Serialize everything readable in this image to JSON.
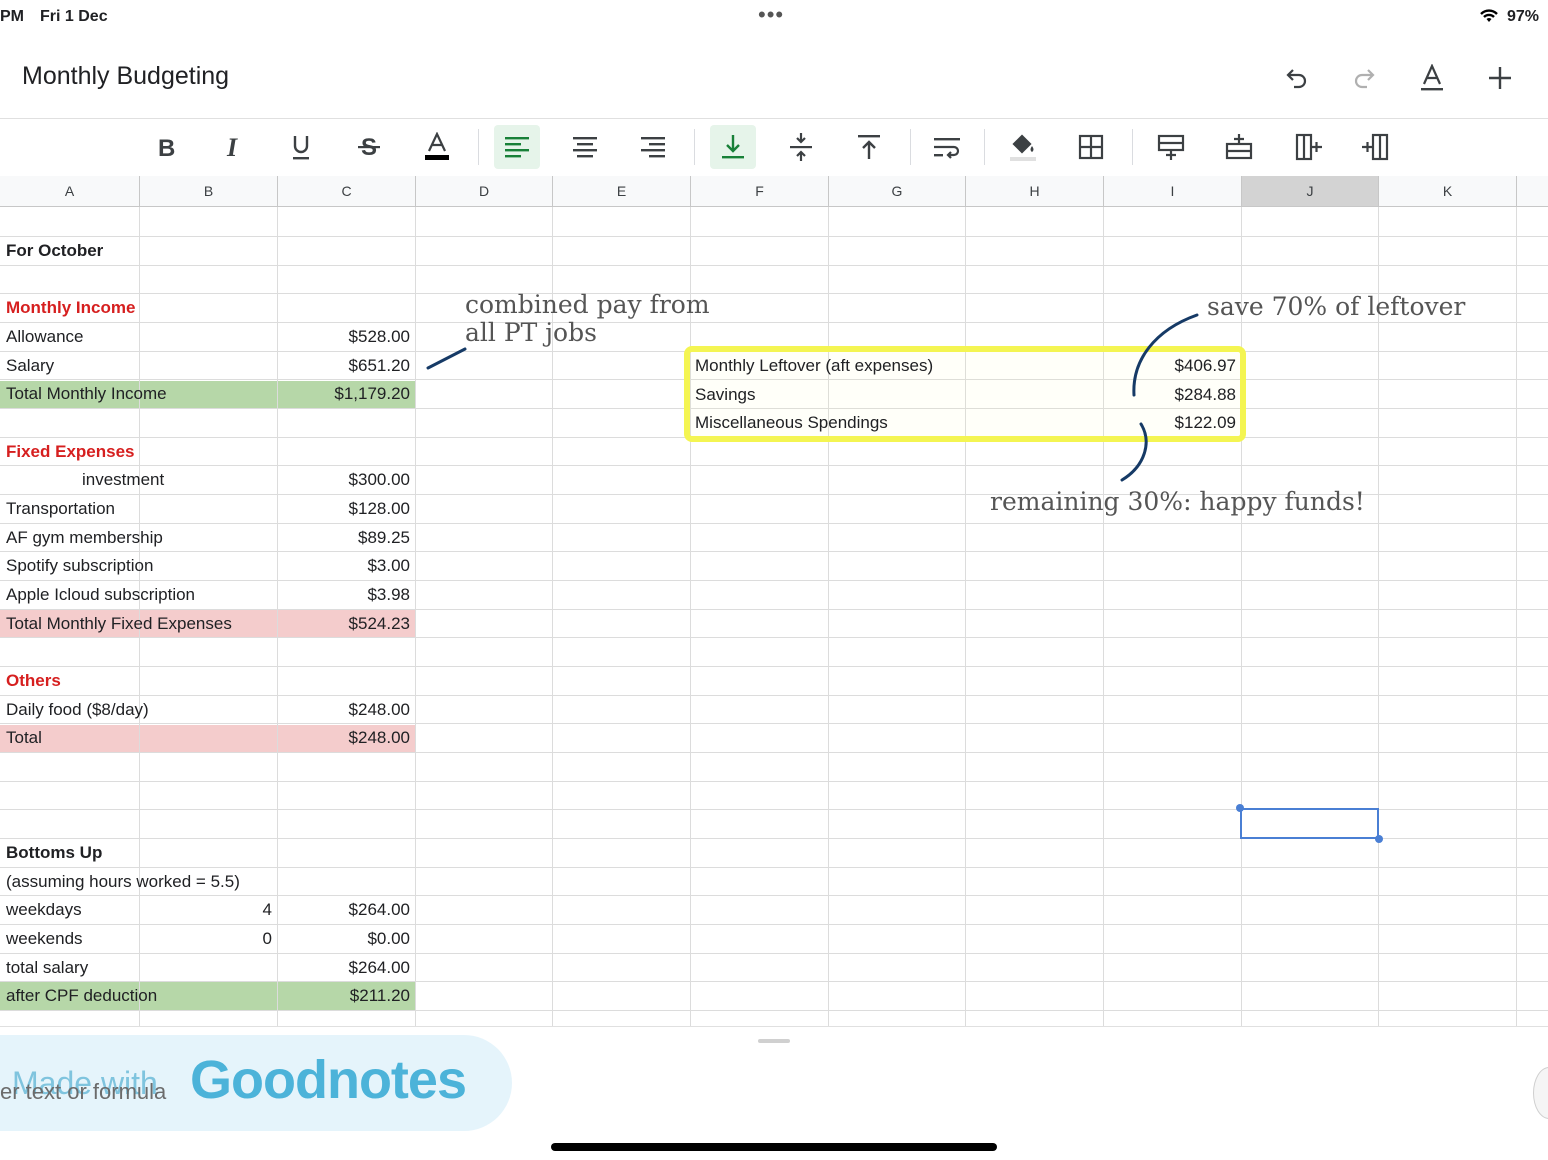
{
  "status": {
    "time": "PM",
    "date": "Fri 1 Dec",
    "battery": "97%"
  },
  "document": {
    "title": "Monthly Budgeting"
  },
  "title_actions": [
    "undo-icon",
    "redo-icon",
    "text-format-icon",
    "add-icon"
  ],
  "toolbar": [
    "bold-icon",
    "italic-icon",
    "underline-icon",
    "strikethrough-icon",
    "text-color-icon",
    "align-left-icon",
    "align-center-icon",
    "align-right-icon",
    "valign-bottom-icon",
    "valign-middle-icon",
    "valign-top-icon",
    "wrap-text-icon",
    "fill-color-icon",
    "borders-icon",
    "insert-row-above-icon",
    "insert-row-below-icon",
    "insert-column-left-icon",
    "insert-column-right-icon"
  ],
  "columns": [
    "A",
    "B",
    "C",
    "D",
    "E",
    "F",
    "G",
    "H",
    "I",
    "J",
    "K"
  ],
  "selected_column": "J",
  "sheet": {
    "for_october": "For October",
    "income": {
      "heading": "Monthly Income",
      "allowance_label": "Allowance",
      "allowance": "$528.00",
      "salary_label": "Salary",
      "salary": "$651.20",
      "total_label": "Total Monthly Income",
      "total": "$1,179.20"
    },
    "fixed": {
      "heading": "Fixed Expenses",
      "investment_label": "investment",
      "investment": "$300.00",
      "transport_label": "Transportation",
      "transport": "$128.00",
      "gym_label": "AF gym membership",
      "gym": "$89.25",
      "spotify_label": "Spotify subscription",
      "spotify": "$3.00",
      "icloud_label": "Apple Icloud subscription",
      "icloud": "$3.98",
      "total_label": "Total Monthly Fixed Expenses",
      "total": "$524.23"
    },
    "others": {
      "heading": "Others",
      "food_label": "Daily food ($8/day)",
      "food": "$248.00",
      "total_label": "Total",
      "total": "$248.00"
    },
    "bottoms": {
      "heading": "Bottoms Up",
      "note": "(assuming hours worked = 5.5)",
      "weekdays_label": "weekdays",
      "weekdays_count": "4",
      "weekdays": "$264.00",
      "weekends_label": "weekends",
      "weekends_count": "0",
      "weekends": "$0.00",
      "total_label": "total salary",
      "total": "$264.00",
      "cpf_label": "after CPF deduction",
      "cpf": "$211.20"
    },
    "leftover": {
      "leftover_label": "Monthly Leftover (aft expenses)",
      "leftover": "$406.97",
      "savings_label": "Savings",
      "savings": "$284.88",
      "misc_label": "Miscellaneous Spendings",
      "misc": "$122.09"
    }
  },
  "annotations": {
    "combined_line1": "combined pay from",
    "combined_line2": "all PT jobs",
    "save": "save 70% of leftover",
    "remaining": "remaining 30%: happy funds!"
  },
  "bottom": {
    "formula_hint": "er text or formula",
    "watermark_prefix": "Made with",
    "watermark_brand": "Goodnotes"
  },
  "colors": {
    "accent_green": "#188038",
    "income_fill": "#b6d7a8",
    "expense_fill": "#f4cccc",
    "heading_red": "#d61f1f",
    "highlighter": "#f4f552",
    "pen_blue": "#163a66"
  }
}
